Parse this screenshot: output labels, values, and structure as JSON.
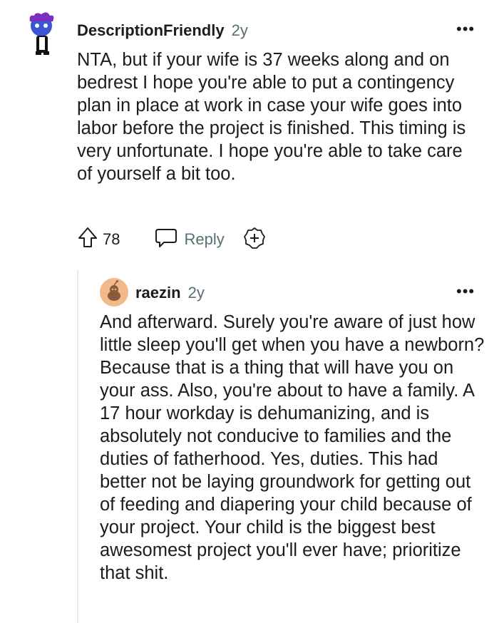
{
  "comments": [
    {
      "author": "DescriptionFriendly",
      "age": "2y",
      "body": "NTA, but if your wife is 37 weeks along and on bedrest I hope you're able to put a contingency plan in place at work in case your wife goes into labor before the project is finished. This timing is very unfortunate. I hope you're able to take care of yourself a bit too.",
      "upvotes": "78",
      "reply_label": "Reply",
      "more_label": "•••"
    },
    {
      "author": "raezin",
      "age": "2y",
      "body": "And afterward. Surely you're aware of just how little sleep you'll get when you have a newborn? Because that is a thing that will have you on your ass. Also, you're about to have a family. A 17 hour workday is dehumanizing, and is absolutely not conducive to families and the duties of fatherhood. Yes, duties. This had better not be laying groundwork for getting out of feeding and diapering your child because of your project. Your child is the biggest best awesomest project you'll ever have; prioritize that shit.",
      "more_label": "•••"
    }
  ],
  "colors": {
    "text": "#1c1c1c",
    "meta": "#576f76",
    "thread_line": "#e5ebee",
    "avatar2_bg": "#f2b98a"
  },
  "icons": [
    "user-avatar-icon",
    "upvote-icon",
    "reply-icon",
    "award-plus-icon",
    "more-options-icon"
  ]
}
